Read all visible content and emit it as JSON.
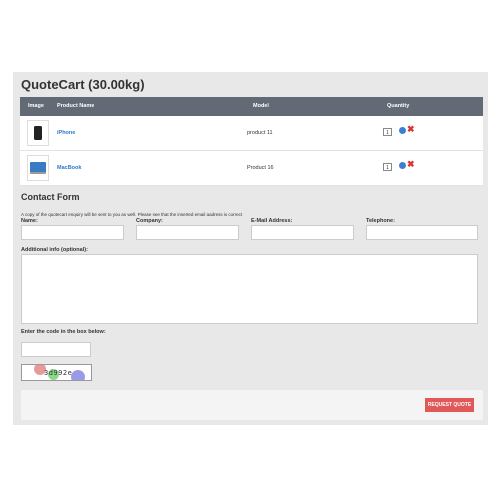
{
  "title": "QuoteCart  (30.00kg)",
  "table": {
    "headers": {
      "image": "Image",
      "name": "Product Name",
      "model": "Model",
      "quantity": "Quantity"
    },
    "rows": [
      {
        "name": "iPhone",
        "model": "product 11",
        "qty": "1",
        "image_icon": "iphone-image"
      },
      {
        "name": "MacBook",
        "model": "Product 16",
        "qty": "1",
        "image_icon": "macbook-image"
      }
    ]
  },
  "contact": {
    "heading": "Contact Form",
    "note": "A copy of the quotecart enquiry will be sent to you as well. Please see that the inserted email aadress is correct",
    "name_label": "Name:",
    "company_label": "Company:",
    "email_label": "E-Mail Address:",
    "phone_label": "Telephone:",
    "info_label": "Additional info (optional):",
    "captcha_label": "Enter the code in the box below:",
    "captcha_text": "3d992e"
  },
  "button": {
    "request_quote": "REQUEST QUOTE"
  },
  "colors": {
    "header_bg": "#626a75",
    "link": "#2a7ac9",
    "button": "#e05858"
  }
}
